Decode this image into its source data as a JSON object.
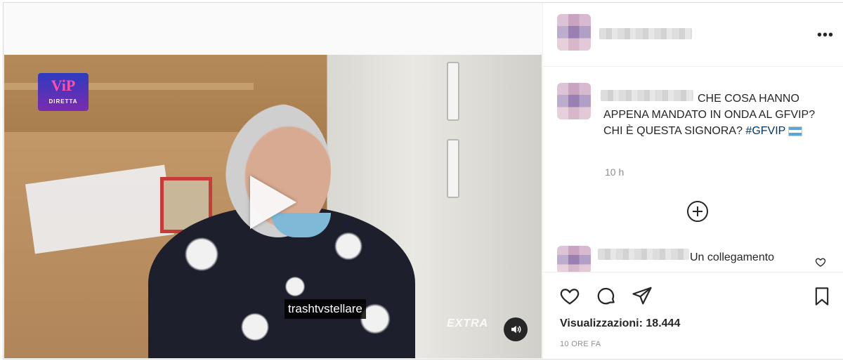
{
  "post": {
    "username_blurred": "",
    "more_label": "•••"
  },
  "caption": {
    "text": "CHE COSA HANNO APPENA MANDATO IN ONDA AL GFVIP? CHI È QUESTA SIGNORA?",
    "hashtag": "#GFVIP",
    "time_ago": "10 h"
  },
  "video": {
    "logo_main": "ViP",
    "logo_sub": "DIRETTA",
    "watermark": "trashtvstellare",
    "broadcaster": "EXTRA"
  },
  "comments": [
    {
      "text": "Un collegamento"
    }
  ],
  "stats": {
    "views_label": "Visualizzazioni: 18.444",
    "posted_label": "10 ORE FA"
  },
  "icons": {
    "play": "play-icon",
    "sound": "speaker-icon",
    "like": "heart-icon",
    "comment": "comment-icon",
    "share": "paper-plane-icon",
    "save": "bookmark-icon",
    "load_more": "plus-circle-icon"
  }
}
